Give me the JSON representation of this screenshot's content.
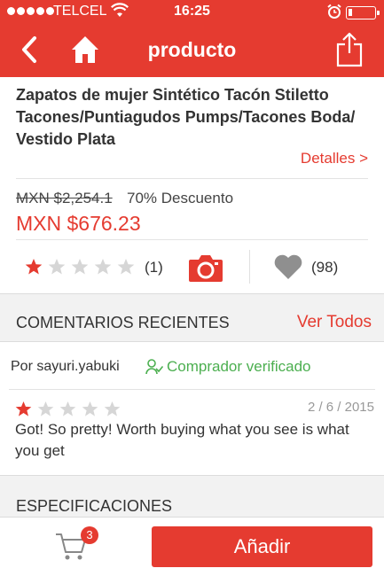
{
  "status_bar": {
    "carrier": "TELCEL",
    "time": "16:25"
  },
  "nav": {
    "title": "producto",
    "back_icon": "chevron-left-icon",
    "home_icon": "home-icon",
    "share_icon": "share-icon"
  },
  "product": {
    "title": "Zapatos de mujer Sintético Tacón Stiletto Tacones/Puntiagudos Pumps/Tacones Boda/ Vestido Plata",
    "details_link": "Detalles >",
    "old_price": "MXN $2,254.1",
    "discount": "70% Descuento",
    "price": "MXN $676.23",
    "rating": 1,
    "rating_max": 5,
    "rating_count": "(1)",
    "likes_count": "(98)"
  },
  "reviews": {
    "header": "COMENTARIOS RECIENTES",
    "see_all": "Ver Todos",
    "author_prefix": "Por",
    "author": "sayuri.yabuki",
    "verified_label": "Comprador verificado",
    "rating": 1,
    "date": "2 / 6 / 2015",
    "text": "Got! So pretty! Worth buying what you see is what you get"
  },
  "specs": {
    "header": "ESPECIFICACIONES"
  },
  "bottom_bar": {
    "cart_count": "3",
    "add_label": "Añadir"
  },
  "colors": {
    "accent": "#e53b30",
    "verified": "#4caf50",
    "star_empty": "#d6d6d6"
  }
}
